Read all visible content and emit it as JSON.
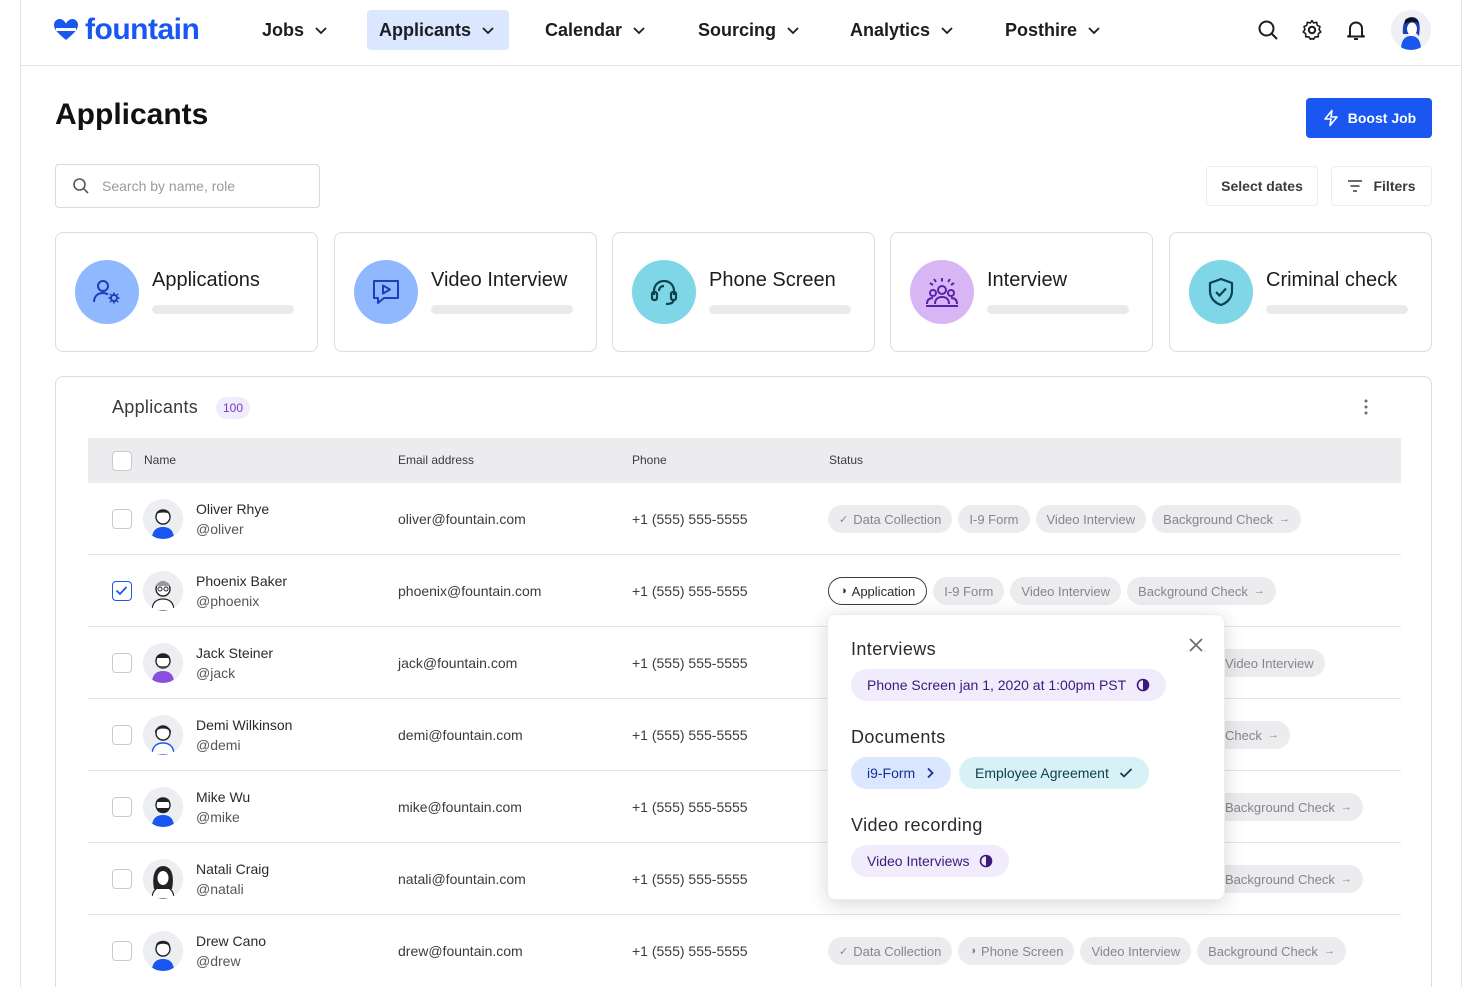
{
  "nav": {
    "logo_text": "fountain",
    "items": [
      {
        "label": "Jobs"
      },
      {
        "label": "Applicants"
      },
      {
        "label": "Calendar"
      },
      {
        "label": "Sourcing"
      },
      {
        "label": "Analytics"
      },
      {
        "label": "Posthire"
      }
    ],
    "active": "Applicants",
    "icons": [
      "search-icon",
      "gear-icon",
      "bell-icon",
      "user-avatar"
    ]
  },
  "header": {
    "title": "Applicants",
    "boost_label": "Boost Job",
    "search_placeholder": "Search by name, role",
    "select_dates_label": "Select dates",
    "filters_label": "Filters"
  },
  "stages": [
    {
      "title": "Applications",
      "icon": "user-gear-icon",
      "color": "#8fb8ff"
    },
    {
      "title": "Video Interview",
      "icon": "video-play-icon",
      "color": "#8fb8ff"
    },
    {
      "title": "Phone Screen",
      "icon": "headset-icon",
      "color": "#7fd6e6"
    },
    {
      "title": "Interview",
      "icon": "people-icon",
      "color": "#d8b6f6"
    },
    {
      "title": "Criminal check",
      "icon": "shield-check-icon",
      "color": "#7fd6e6"
    }
  ],
  "table": {
    "title": "Applicants",
    "count": "100",
    "headers": {
      "name": "Name",
      "email": "Email address",
      "phone": "Phone",
      "status": "Status"
    },
    "rows": [
      {
        "name": "Oliver Rhye",
        "handle": "@oliver",
        "email": "oliver@fountain.com",
        "phone": "+1 (555) 555-5555",
        "checked": false,
        "status": [
          {
            "label": "Data Collection",
            "pre": "✓"
          },
          {
            "label": "I-9 Form"
          },
          {
            "label": "Video Interview"
          },
          {
            "label": "Background Check",
            "post": "→"
          }
        ]
      },
      {
        "name": "Phoenix Baker",
        "handle": "@phoenix",
        "email": "phoenix@fountain.com",
        "phone": "+1 (555) 555-5555",
        "checked": true,
        "status": [
          {
            "label": "Application",
            "pre": "◑",
            "outlined": true
          },
          {
            "label": "I-9 Form"
          },
          {
            "label": "Video Interview"
          },
          {
            "label": "Background Check",
            "post": "→"
          }
        ]
      },
      {
        "name": "Jack Steiner",
        "handle": "@jack",
        "email": "jack@fountain.com",
        "phone": "+1 (555) 555-5555",
        "checked": false,
        "status": [
          {
            "label": "Video Interview"
          }
        ]
      },
      {
        "name": "Demi Wilkinson",
        "handle": "@demi",
        "email": "demi@fountain.com",
        "phone": "+1 (555) 555-5555",
        "checked": false,
        "status": [
          {
            "label": "Check",
            "post": "→"
          }
        ]
      },
      {
        "name": "Mike Wu",
        "handle": "@mike",
        "email": "mike@fountain.com",
        "phone": "+1 (555) 555-5555",
        "checked": false,
        "status": [
          {
            "label": "Background Check",
            "post": "→"
          }
        ]
      },
      {
        "name": "Natali Craig",
        "handle": "@natali",
        "email": "natali@fountain.com",
        "phone": "+1 (555) 555-5555",
        "checked": false,
        "status": [
          {
            "label": "Background Check",
            "post": "→"
          }
        ]
      },
      {
        "name": "Drew Cano",
        "handle": "@drew",
        "email": "drew@fountain.com",
        "phone": "+1 (555) 555-5555",
        "checked": false,
        "status": [
          {
            "label": "Data Collection",
            "pre": "✓"
          },
          {
            "label": "Phone Screen",
            "pre": "◑"
          },
          {
            "label": "Video Interview"
          },
          {
            "label": "Background Check",
            "post": "→"
          }
        ]
      }
    ]
  },
  "popover": {
    "interviews_title": "Interviews",
    "interview_chip": "Phone Screen jan 1, 2020 at 1:00pm PST",
    "documents_title": "Documents",
    "doc_chip_1": "i9-Form",
    "doc_chip_2": "Employee Agreement",
    "video_title": "Video recording",
    "video_chip": "Video Interviews"
  },
  "colors": {
    "accent": "#1a56f0",
    "active_nav_bg": "#dbe6ff",
    "badge_purple": "#6b3fc7"
  }
}
